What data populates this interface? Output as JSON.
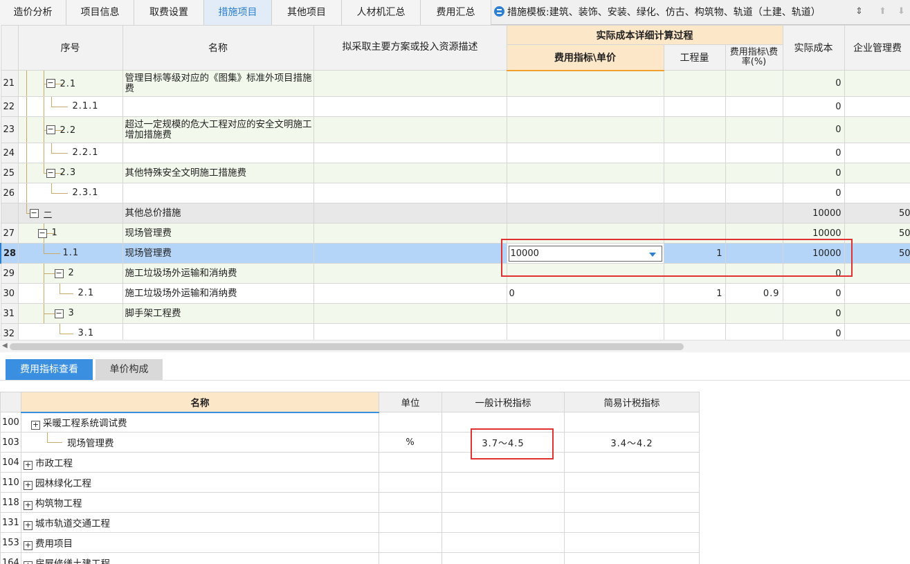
{
  "tabs": [
    {
      "label": "造价分析",
      "active": false
    },
    {
      "label": "项目信息",
      "active": false
    },
    {
      "label": "取费设置",
      "active": false
    },
    {
      "label": "措施项目",
      "active": true
    },
    {
      "label": "其他项目",
      "active": false
    },
    {
      "label": "人材机汇总",
      "active": false
    },
    {
      "label": "费用汇总",
      "active": false
    }
  ],
  "template_label": "措施模板:建筑、装饰、安装、绿化、仿古、构筑物、轨道（土建、轨道）",
  "grid": {
    "headers": {
      "seq": "序号",
      "name": "名称",
      "desc": "拟采取主要方案或投入资源描述",
      "group": "实际成本详细计算过程",
      "price": "费用指标\\单价",
      "qty": "工程量",
      "rate": "费用指标\\费率(%)",
      "cost": "实际成本",
      "mgmt": "企业管理费"
    },
    "rows": [
      {
        "rownum": "21",
        "seq": "2.1",
        "name": "管理目标等级对应的《图集》标准外项目措施费",
        "price": "",
        "qty": "",
        "rate": "",
        "cost": "0",
        "mgmt": ""
      },
      {
        "rownum": "22",
        "seq": "2.1.1",
        "name": "",
        "price": "",
        "qty": "",
        "rate": "",
        "cost": "0",
        "mgmt": ""
      },
      {
        "rownum": "23",
        "seq": "2.2",
        "name": "超过一定规模的危大工程对应的安全文明施工增加措施费",
        "price": "",
        "qty": "",
        "rate": "",
        "cost": "0",
        "mgmt": ""
      },
      {
        "rownum": "24",
        "seq": "2.2.1",
        "name": "",
        "price": "",
        "qty": "",
        "rate": "",
        "cost": "0",
        "mgmt": ""
      },
      {
        "rownum": "25",
        "seq": "2.3",
        "name": "其他特殊安全文明施工措施费",
        "price": "",
        "qty": "",
        "rate": "",
        "cost": "0",
        "mgmt": ""
      },
      {
        "rownum": "26",
        "seq": "2.3.1",
        "name": "",
        "price": "",
        "qty": "",
        "rate": "",
        "cost": "0",
        "mgmt": ""
      },
      {
        "rownum": "",
        "seq": "二",
        "name": "其他总价措施",
        "price": "",
        "qty": "",
        "rate": "",
        "cost": "10000",
        "mgmt": "50"
      },
      {
        "rownum": "27",
        "seq": "1",
        "name": "现场管理费",
        "price": "",
        "qty": "",
        "rate": "",
        "cost": "10000",
        "mgmt": "50"
      },
      {
        "rownum": "28",
        "seq": "1.1",
        "name": "现场管理费",
        "price": "10000",
        "qty": "1",
        "rate": "",
        "cost": "10000",
        "mgmt": "50"
      },
      {
        "rownum": "29",
        "seq": "2",
        "name": "施工垃圾场外运输和消纳费",
        "price": "",
        "qty": "",
        "rate": "",
        "cost": "0",
        "mgmt": ""
      },
      {
        "rownum": "30",
        "seq": "2.1",
        "name": "施工垃圾场外运输和消纳费",
        "price": "0",
        "qty": "1",
        "rate": "0.9",
        "cost": "0",
        "mgmt": ""
      },
      {
        "rownum": "31",
        "seq": "3",
        "name": "脚手架工程费",
        "price": "",
        "qty": "",
        "rate": "",
        "cost": "0",
        "mgmt": ""
      },
      {
        "rownum": "32",
        "seq": "3.1",
        "name": "",
        "price": "",
        "qty": "",
        "rate": "",
        "cost": "0",
        "mgmt": ""
      }
    ]
  },
  "panel_tabs": {
    "active": "费用指标查看",
    "inactive": "单价构成"
  },
  "lower": {
    "headers": {
      "name": "名称",
      "unit": "单位",
      "general": "一般计税指标",
      "simple": "简易计税指标"
    },
    "rows": [
      {
        "rownum": "100",
        "name": "采暖工程系统调试费",
        "expander": "+",
        "unit": "",
        "general": "",
        "simple": ""
      },
      {
        "rownum": "103",
        "name": "现场管理费",
        "expander": "",
        "unit": "%",
        "general": "3.7～4.5",
        "simple": "3.4～4.2"
      },
      {
        "rownum": "104",
        "name": "市政工程",
        "expander": "+",
        "unit": "",
        "general": "",
        "simple": ""
      },
      {
        "rownum": "110",
        "name": "园林绿化工程",
        "expander": "+",
        "unit": "",
        "general": "",
        "simple": ""
      },
      {
        "rownum": "118",
        "name": "构筑物工程",
        "expander": "+",
        "unit": "",
        "general": "",
        "simple": ""
      },
      {
        "rownum": "131",
        "name": "城市轨道交通工程",
        "expander": "+",
        "unit": "",
        "general": "",
        "simple": ""
      },
      {
        "rownum": "153",
        "name": "费用项目",
        "expander": "+",
        "unit": "",
        "general": "",
        "simple": ""
      },
      {
        "rownum": "164",
        "name": "房屋修缮土建工程",
        "expander": "+",
        "unit": "",
        "general": "",
        "simple": ""
      }
    ]
  },
  "colors": {
    "accent": "#2d7fd3",
    "selected_row": "#b5d5f8",
    "highlight": "#e03030",
    "header_orange": "#fde7c9"
  }
}
